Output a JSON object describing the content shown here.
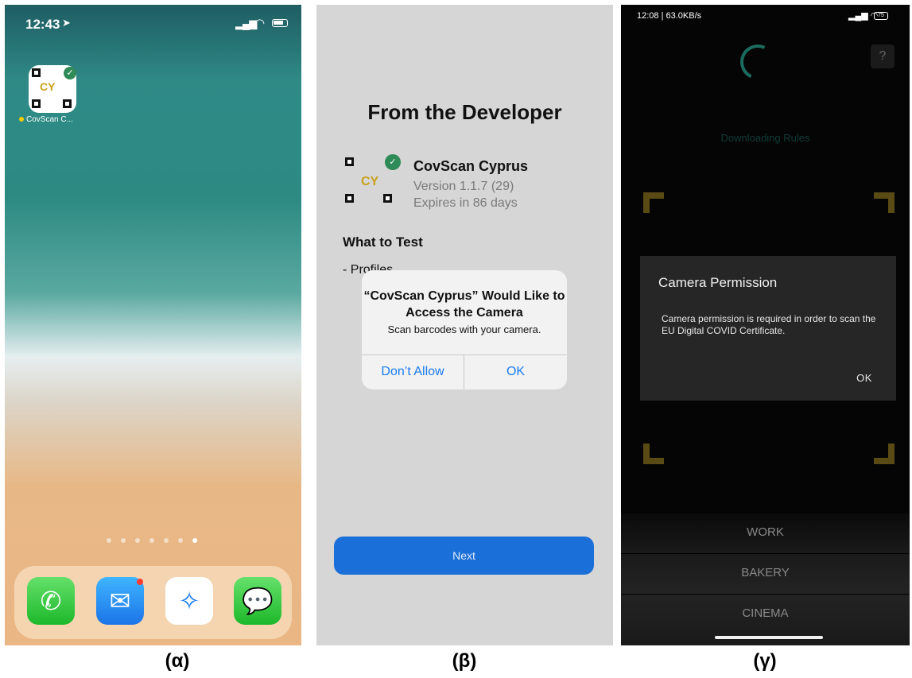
{
  "panel_a": {
    "status": {
      "time": "12:43"
    },
    "app_label": "CovScan C...",
    "app_icon_text": "CY",
    "caption": "(α)"
  },
  "panel_b": {
    "title": "From the Developer",
    "app_name": "CovScan Cyprus",
    "version": "Version 1.1.7 (29)",
    "expires": "Expires in 86 days",
    "what_to_test": "What to Test",
    "profiles": "- Profiles",
    "app_icon_text": "CY",
    "alert": {
      "title": "“CovScan Cyprus” Would Like to Access the Camera",
      "message": "Scan barcodes with your camera.",
      "deny_label": "Don’t Allow",
      "ok_label": "OK"
    },
    "next_label": "Next",
    "caption": "(β)"
  },
  "panel_c": {
    "status": {
      "left": "12:08 | 63.0KB/s",
      "battery": "75"
    },
    "help": "?",
    "downloading": "Downloading Rules",
    "dialog": {
      "title": "Camera Permission",
      "message": "Camera permission is required in order to scan the EU Digital COVID Certificate.",
      "ok_label": "OK"
    },
    "options": [
      "WORK",
      "BAKERY",
      "CINEMA"
    ],
    "caption": "(γ)"
  },
  "colors": {
    "ios_blue": "#1a7cf0",
    "next_button": "#1a6fd8",
    "dialog_bg": "#262626",
    "corner_gold": "#5a4a14",
    "spinner_teal": "#1b6b5e"
  }
}
